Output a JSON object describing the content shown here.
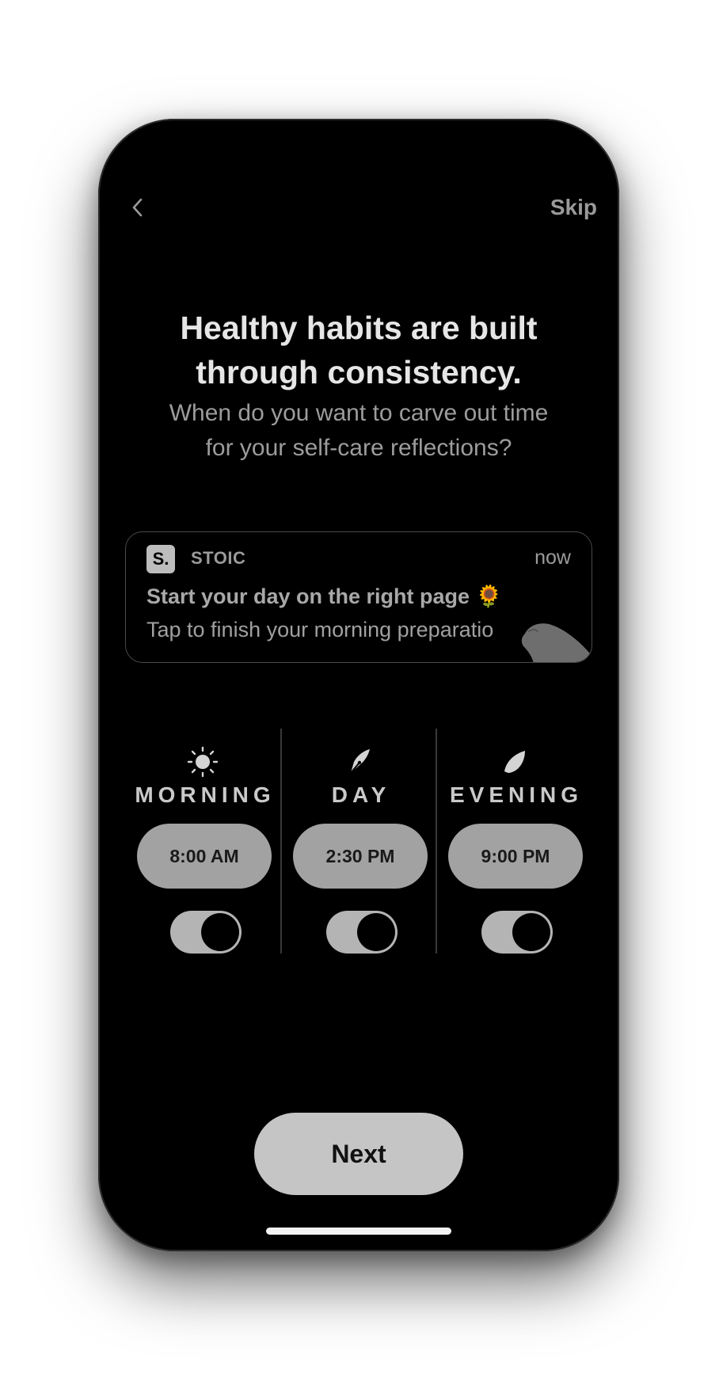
{
  "nav": {
    "back_icon": "chevron-left-icon",
    "skip_label": "Skip"
  },
  "header": {
    "title_line1": "Healthy habits are built",
    "title_line2": "through consistency.",
    "subtitle_line1": "When do you want to carve out time",
    "subtitle_line2": "for your self-care reflections?"
  },
  "notification": {
    "logo_text": "S.",
    "app_name": "STOIC",
    "time": "now",
    "title": "Start your day on the right page 🌻",
    "body": "Tap to finish your morning preparatio"
  },
  "schedule": [
    {
      "icon": "sun-icon",
      "label": "MORNING",
      "time": "8:00 AM",
      "enabled": true
    },
    {
      "icon": "pen-nib-icon",
      "label": "DAY",
      "time": "2:30 PM",
      "enabled": true
    },
    {
      "icon": "moon-icon",
      "label": "EVENING",
      "time": "9:00 PM",
      "enabled": true
    }
  ],
  "footer": {
    "next_label": "Next"
  },
  "colors": {
    "background": "#000000",
    "text_primary": "#e6e6e6",
    "text_secondary": "#9c9c9c",
    "pill": "#a2a2a2",
    "button": "#c5c5c5"
  }
}
